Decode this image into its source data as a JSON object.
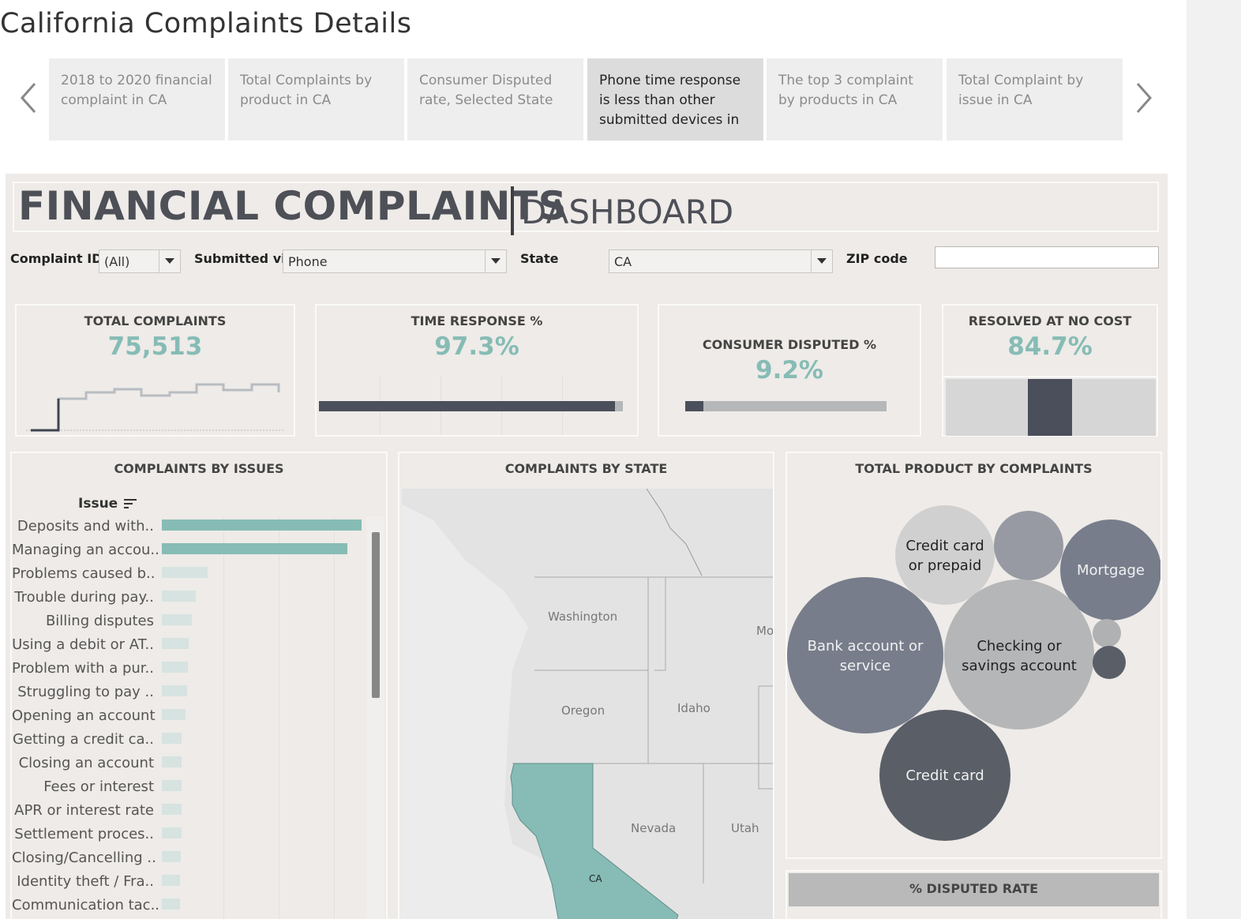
{
  "story": {
    "title": "California Complaints Details",
    "points": [
      "2018 to 2020 financial complaint in CA",
      "Total Complaints by product in CA",
      "Consumer Disputed rate, Selected State",
      "Phone time response is less than other submitted devices in",
      "The top 3 complaint by products in CA",
      "Total Complaint by issue in CA"
    ],
    "active_index": 3
  },
  "dashboard": {
    "title_main": "FINANCIAL COMPLAINTS",
    "title_sub": "DASHBOARD"
  },
  "filters": {
    "complaint_id": {
      "label": "Complaint ID",
      "value": "(All)"
    },
    "submitted_via": {
      "label": "Submitted via",
      "value": "Phone"
    },
    "state": {
      "label": "State",
      "value": "CA"
    },
    "zip": {
      "label": "ZIP code",
      "value": ""
    }
  },
  "kpis": {
    "total_complaints": {
      "title": "TOTAL COMPLAINTS",
      "value": "75,513"
    },
    "time_response": {
      "title": "TIME RESPONSE %",
      "value": "97.3%",
      "fraction": 0.973
    },
    "consumer_disputed": {
      "title": "CONSUMER DISPUTED %",
      "value": "9.2%",
      "fraction": 0.092
    },
    "resolved_no_cost": {
      "title": "RESOLVED AT NO COST",
      "value": "84.7%"
    }
  },
  "issues_panel": {
    "title": "COMPLAINTS BY ISSUES",
    "column_header": "Issue",
    "items": [
      {
        "label": "Deposits and with..",
        "value": 100
      },
      {
        "label": "Managing an accou..",
        "value": 93
      },
      {
        "label": "Problems caused b..",
        "value": 23
      },
      {
        "label": "Trouble during pay..",
        "value": 17
      },
      {
        "label": "Billing disputes",
        "value": 15
      },
      {
        "label": "Using a debit or AT..",
        "value": 13.5
      },
      {
        "label": "Problem with a pur..",
        "value": 13
      },
      {
        "label": "Struggling to pay ..",
        "value": 12.5
      },
      {
        "label": "Opening an account",
        "value": 12
      },
      {
        "label": "Getting a credit ca..",
        "value": 10
      },
      {
        "label": "Closing an account",
        "value": 10
      },
      {
        "label": "Fees or interest",
        "value": 10
      },
      {
        "label": "APR or interest rate",
        "value": 10
      },
      {
        "label": "Settlement proces..",
        "value": 10
      },
      {
        "label": "Closing/Cancelling ..",
        "value": 9.5
      },
      {
        "label": "Identity theft / Fra..",
        "value": 9
      },
      {
        "label": "Communication tac..",
        "value": 9
      }
    ]
  },
  "map_panel": {
    "title": "COMPLAINTS BY STATE",
    "labels": [
      "Washington",
      "Oregon",
      "Idaho",
      "Nevada",
      "Utah",
      "Mo",
      "CA"
    ]
  },
  "products_panel": {
    "title": "TOTAL PRODUCT BY COMPLAINTS",
    "bubbles": [
      {
        "label": "Credit card or prepaid",
        "color": "#d0d0d0"
      },
      {
        "label": "",
        "color": "#979aa2"
      },
      {
        "label": "Mortgage",
        "color": "#777d8b"
      },
      {
        "label": "Bank account or service",
        "color": "#777d8b"
      },
      {
        "label": "Checking or savings account",
        "color": "#b5b6b7"
      },
      {
        "label": "",
        "color": "#b0b1b3"
      },
      {
        "label": "",
        "color": "#5a5e67"
      },
      {
        "label": "Credit card",
        "color": "#5a5e67"
      }
    ]
  },
  "disputed_panel": {
    "title": "% DISPUTED RATE"
  },
  "colors": {
    "accent": "#86bcb5",
    "dark": "#4a4f5b",
    "grey_bar": "#b5b7b8",
    "background": "#eeebe8"
  }
}
